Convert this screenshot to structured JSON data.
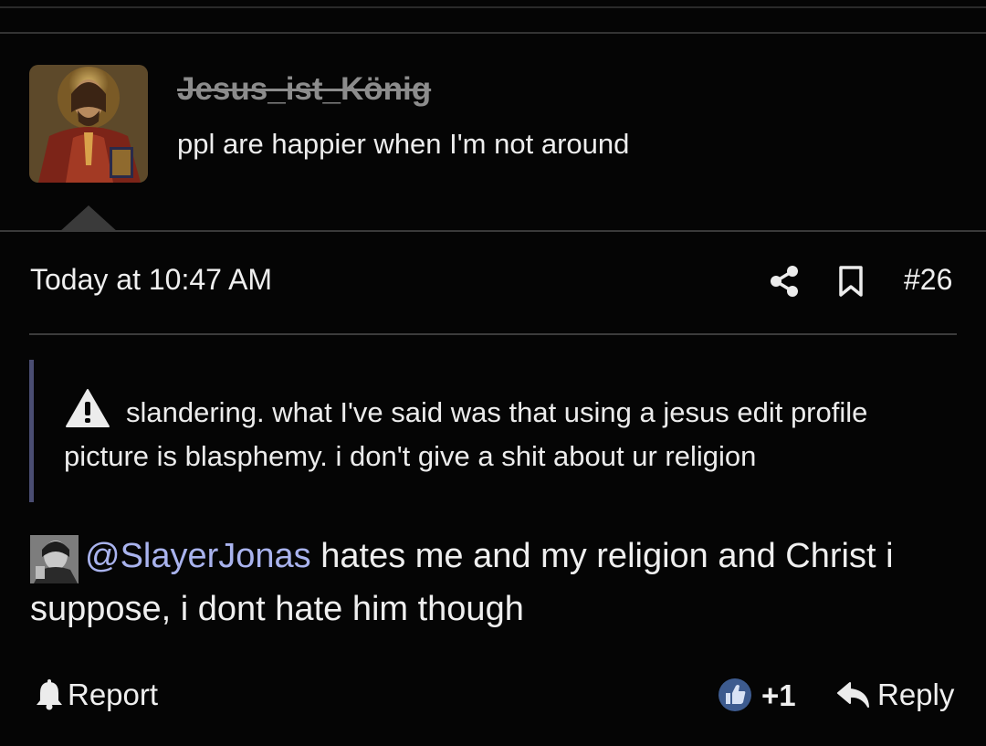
{
  "user": {
    "username": "Jesus_ist_König",
    "title": "ppl are happier when I'm not around",
    "avatar_icon": "icon-portrait-avatar"
  },
  "post": {
    "date": "Today at 10:47 AM",
    "number": "#26",
    "share_icon": "share-icon",
    "bookmark_icon": "bookmark-icon"
  },
  "quote": {
    "icon": "warning-icon",
    "text_line1": "slandering. what I've said was that using a jesus edit profile",
    "text_line2": "picture is blasphemy. i don't give a shit about ur religion"
  },
  "body": {
    "mention": "@SlayerJonas",
    "text_after_mention": " hates me and my religion and Christ i suppose, i dont hate him though"
  },
  "footer": {
    "report_label": "Report",
    "like_count": "+1",
    "reply_label": "Reply"
  },
  "colors": {
    "background": "#050505",
    "text": "#ececec",
    "username": "#8c8c8c",
    "mention": "#a9b3ee",
    "quote_bar": "#4a4d72",
    "like_badge": "#3d5b8f"
  }
}
